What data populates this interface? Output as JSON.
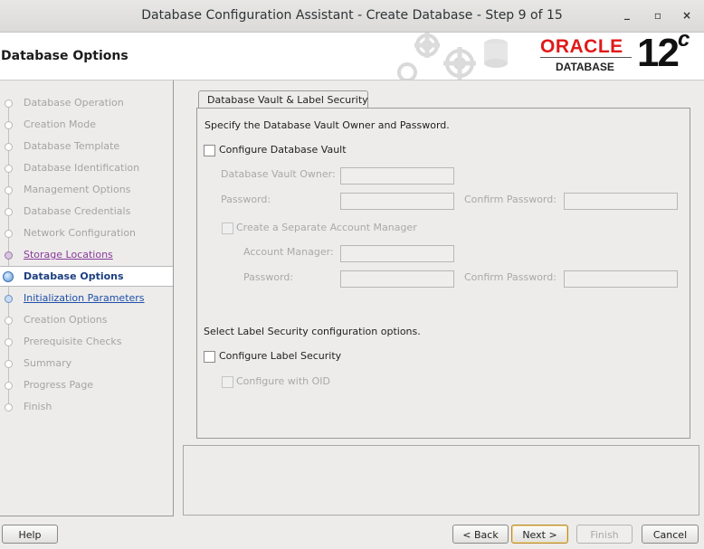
{
  "window": {
    "title": "Database Configuration Assistant - Create Database - Step 9 of 15",
    "min_icon": "minimize-icon",
    "max_icon": "maximize-icon",
    "close_icon": "close-icon"
  },
  "header": {
    "page_title": "Database Options",
    "logo_brand": "ORACLE",
    "logo_product": "DATABASE",
    "logo_version": "12",
    "logo_version_suffix": "c"
  },
  "steps": [
    {
      "label": "Database Operation",
      "state": "done"
    },
    {
      "label": "Creation Mode",
      "state": "done"
    },
    {
      "label": "Database Template",
      "state": "done"
    },
    {
      "label": "Database Identification",
      "state": "done"
    },
    {
      "label": "Management Options",
      "state": "done"
    },
    {
      "label": "Database Credentials",
      "state": "done"
    },
    {
      "label": "Network Configuration",
      "state": "done"
    },
    {
      "label": "Storage Locations",
      "state": "visited"
    },
    {
      "label": "Database Options",
      "state": "current"
    },
    {
      "label": "Initialization Parameters",
      "state": "link"
    },
    {
      "label": "Creation Options",
      "state": "disabled"
    },
    {
      "label": "Prerequisite Checks",
      "state": "disabled"
    },
    {
      "label": "Summary",
      "state": "disabled"
    },
    {
      "label": "Progress Page",
      "state": "disabled"
    },
    {
      "label": "Finish",
      "state": "disabled"
    }
  ],
  "tab": {
    "label": "Database Vault & Label Security"
  },
  "vault": {
    "instruction": "Specify the Database Vault Owner and Password.",
    "configure_label": "Configure Database Vault",
    "owner_label": "Database Vault Owner:",
    "password_label": "Password:",
    "confirm_label": "Confirm Password:",
    "separate_label": "Create a Separate Account Manager",
    "manager_label": "Account Manager:",
    "manager_password_label": "Password:",
    "manager_confirm_label": "Confirm Password:"
  },
  "label_security": {
    "instruction": "Select Label Security configuration options.",
    "configure_label": "Configure Label Security",
    "oid_label": "Configure with OID"
  },
  "buttons": {
    "help": "Help",
    "back": "< Back",
    "next": "Next >",
    "finish": "Finish",
    "cancel": "Cancel"
  },
  "colors": {
    "oracle_red": "#e01a1a",
    "link_blue": "#1f4fa8",
    "visited_purple": "#8a3a9a"
  }
}
